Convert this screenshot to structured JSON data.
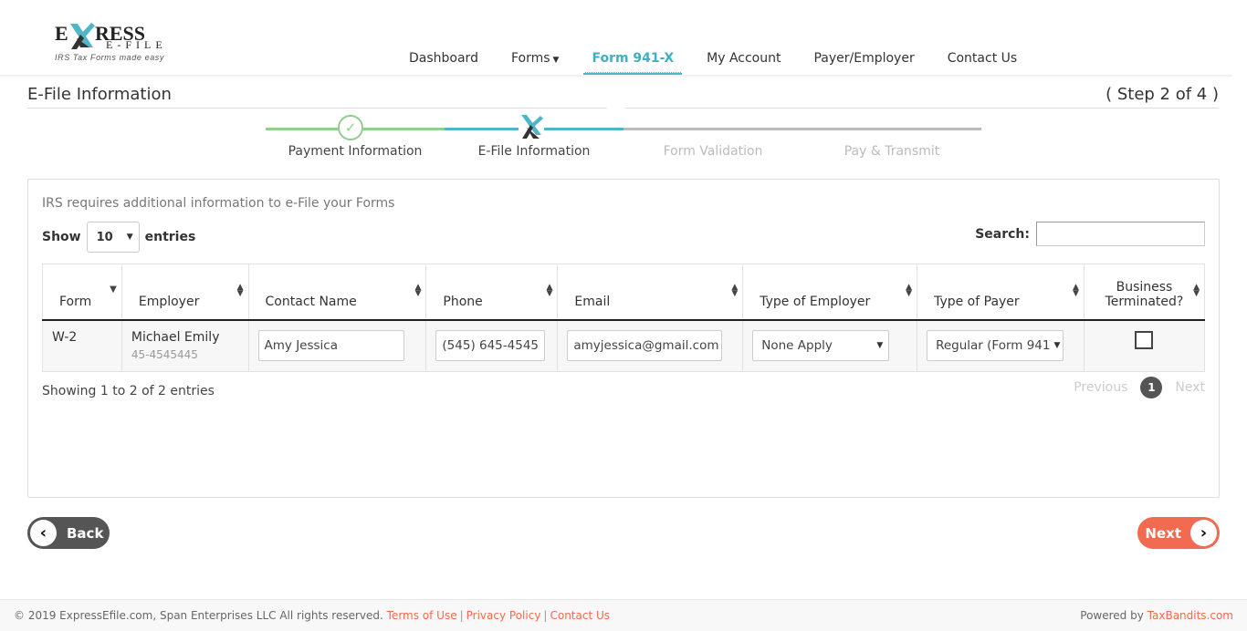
{
  "brand": {
    "logo_word": "EXPRESS",
    "logo_sub": "E-FILE",
    "tagline": "IRS Tax Forms made easy",
    "accent_color": "#4eb6c8",
    "action_color": "#f26a4f"
  },
  "nav": {
    "items": [
      {
        "label": "Dashboard"
      },
      {
        "label": "Forms"
      },
      {
        "label": "Form 941-X",
        "active": true
      },
      {
        "label": "My Account"
      },
      {
        "label": "Payer/Employer"
      },
      {
        "label": "Contact Us"
      }
    ]
  },
  "page": {
    "title": "E-File Information",
    "step_indicator": "( Step 2 of 4 )"
  },
  "stepper": {
    "steps": [
      {
        "label": "Payment Information",
        "status": "completed"
      },
      {
        "label": "E-File Information",
        "status": "current"
      },
      {
        "label": "Form Validation",
        "status": "pending"
      },
      {
        "label": "Pay & Transmit",
        "status": "pending"
      }
    ]
  },
  "panel": {
    "note": "IRS requires additional information to e-File your Forms",
    "show_label": "Show",
    "entries_label": "entries",
    "page_size": "10",
    "search_label": "Search:",
    "search_value": ""
  },
  "table": {
    "columns": [
      "Form",
      "Employer",
      "Contact Name",
      "Phone",
      "Email",
      "Type of Employer",
      "Type of Payer",
      "Business Terminated?"
    ],
    "rows": [
      {
        "form": "W-2",
        "employer_name": "Michael Emily",
        "employer_ein": "45-4545445",
        "contact_name": "Amy Jessica",
        "phone": "(545) 645-4545",
        "email": "amyjessica@gmail.com",
        "type_of_employer": "None Apply",
        "type_of_payer": "Regular (Form 941",
        "business_terminated": false
      }
    ]
  },
  "pagination": {
    "summary": "Showing 1 to 2 of 2 entries",
    "previous": "Previous",
    "current_page": "1",
    "next": "Next"
  },
  "actions": {
    "back": "Back",
    "next": "Next"
  },
  "footer": {
    "copyright": "© 2019 ExpressEfile.com, Span Enterprises LLC All rights reserved.",
    "links": [
      "Terms of Use",
      "Privacy Policy",
      "Contact Us"
    ],
    "powered_by": "Powered by",
    "powered_link": "TaxBandits.com"
  }
}
